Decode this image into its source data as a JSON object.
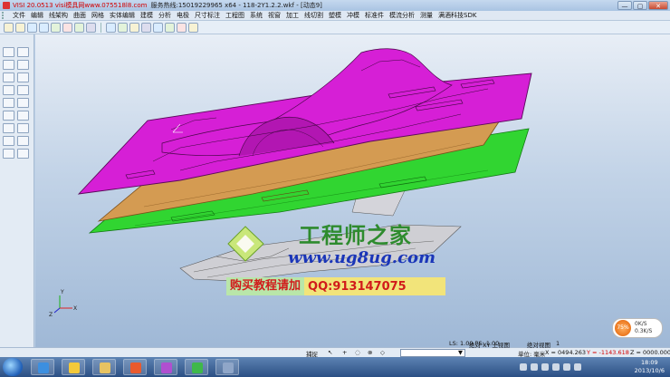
{
  "window": {
    "title_red": "VISI 20.0513 visi模具网www.075518l8.com",
    "title_dark": "服务热线:15019229965 x64 - 118-2Y1.2.2.wkf - [动态9]",
    "min_glyph": "—",
    "max_glyph": "▢",
    "close_glyph": "✕"
  },
  "menu": [
    "文件",
    "编辑",
    "线架构",
    "曲面",
    "网格",
    "实体编辑",
    "建模",
    "分析",
    "电极",
    "尺寸标注",
    "工程图",
    "系统",
    "视窗",
    "加工",
    "线切割",
    "塑模",
    "冲模",
    "标准件",
    "模流分析",
    "测量",
    "满酒科技SDK"
  ],
  "watermark": {
    "title": "工程师之家",
    "url": "www.ug8ug.com",
    "buy_text": "购买教程请加",
    "qq_text": "QQ:913147075"
  },
  "speed": {
    "percent": "75%",
    "up": "0K/S",
    "down": "0.3K/S"
  },
  "status": {
    "snap_label": "捕捉",
    "dropdown_arrow": "▼",
    "ls_value": "LS: 1.00 PS: 1.00",
    "view_label": "绝对 XY 上视图",
    "view2_label": "绝对视图",
    "view2_value": "1",
    "unit_label": "单位: 毫米",
    "x_coord": "X = 0494.263",
    "y_coord": "Y = -1143.618",
    "z_coord": "Z = 0000.000"
  },
  "clock": {
    "time": "18:09",
    "date": "2013/10/6"
  },
  "colors": {
    "magenta_plate": "#d61fd6",
    "orange_plate": "#d49b52",
    "green_plate": "#31d531",
    "watermark_green": "#2e8b2e",
    "watermark_blue": "#1a35b8",
    "watermark_red": "#d11b1b"
  }
}
